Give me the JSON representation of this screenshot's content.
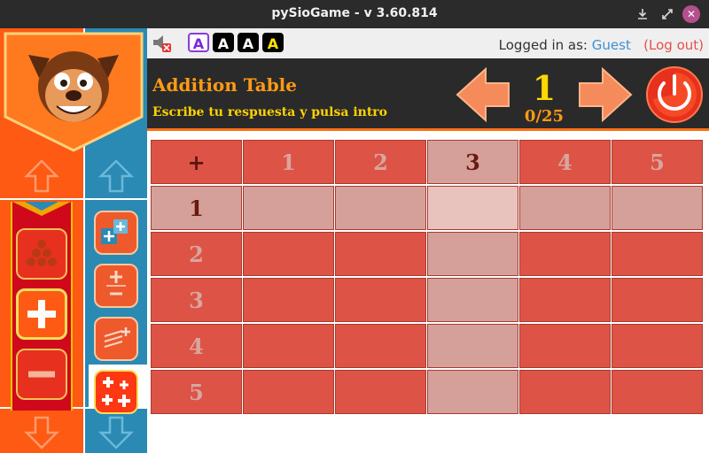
{
  "window": {
    "title": "pySioGame - v 3.60.814",
    "minimize_icon": "download-icon",
    "maximize_icon": "expand-icon",
    "close_symbol": "✕"
  },
  "topbar": {
    "font_buttons": [
      "A",
      "A",
      "A",
      "A"
    ],
    "login_prefix": "Logged in as:",
    "user": "Guest",
    "logout": "(Log out)"
  },
  "header": {
    "game_title": "Addition Table",
    "instruction": "Escribe tu respuesta y pulsa intro",
    "level": "1",
    "score": "0/25"
  },
  "board": {
    "corner": "+",
    "columns": [
      "1",
      "2",
      "3",
      "4",
      "5"
    ],
    "rows": [
      "1",
      "2",
      "3",
      "4",
      "5"
    ],
    "highlight_row": 1,
    "highlight_col": 3
  },
  "colors": {
    "orange": "#ff5a14",
    "teal": "#2b8ab3",
    "cell": "#dd5346",
    "highlight": "#d6a09a",
    "header_bg": "#2a2a2a",
    "level_yellow": "#ffd800"
  }
}
